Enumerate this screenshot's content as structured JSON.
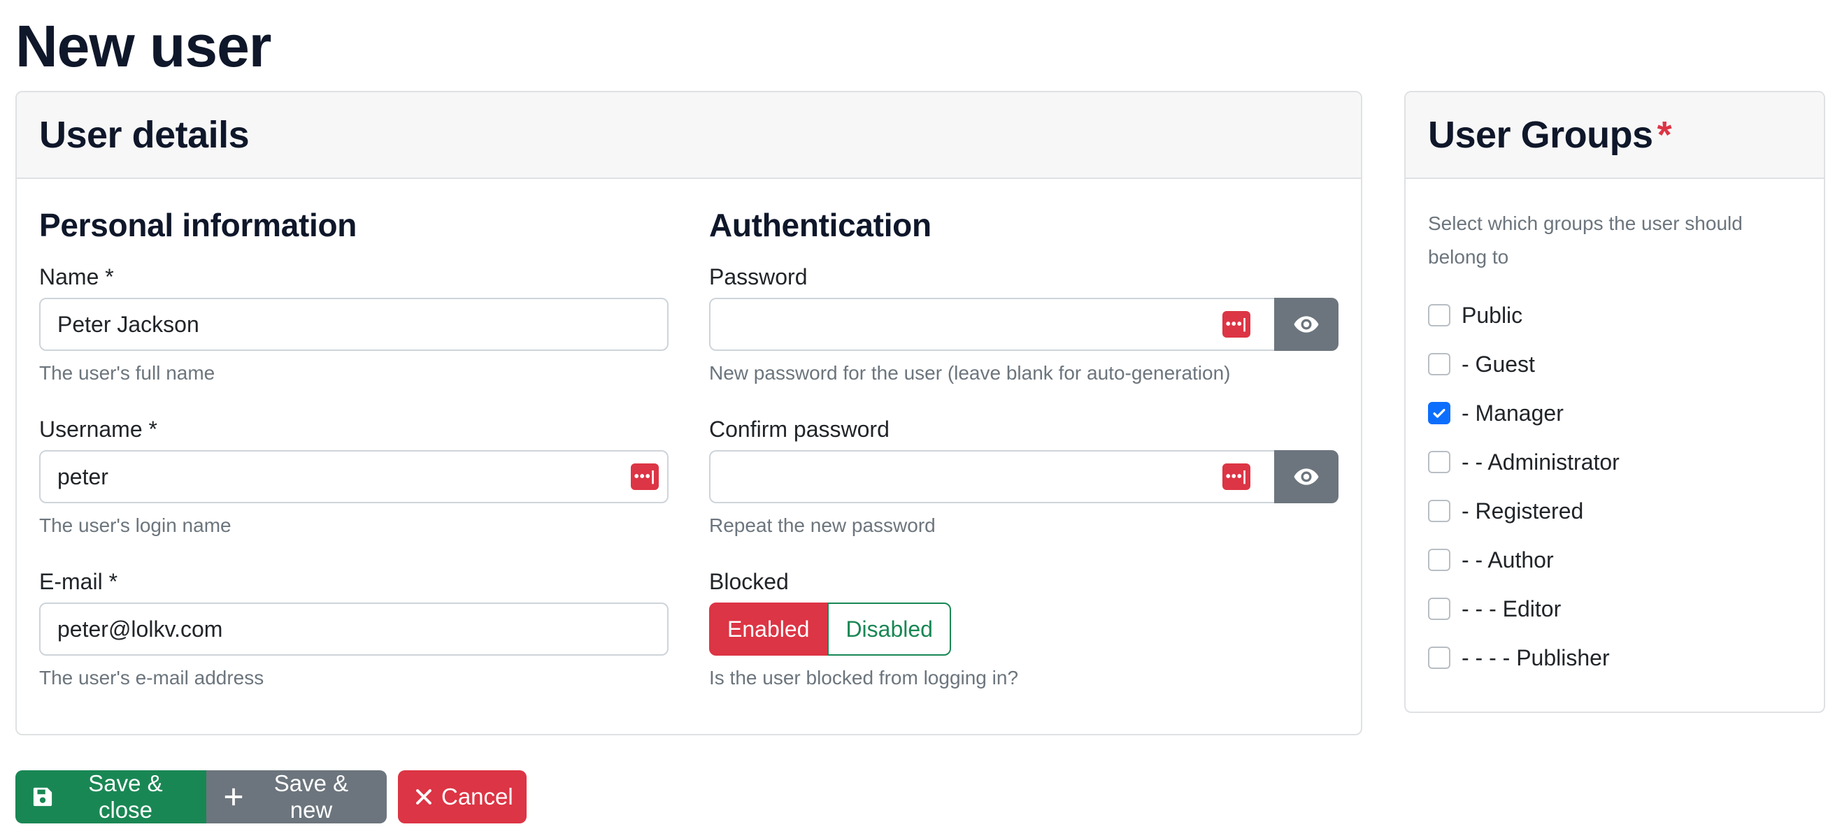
{
  "page": {
    "title": "New user"
  },
  "details": {
    "title": "User details",
    "personal": {
      "title": "Personal information",
      "name": {
        "label": "Name *",
        "value": "Peter Jackson",
        "help": "The user's full name"
      },
      "username": {
        "label": "Username *",
        "value": "peter",
        "help": "The user's login name"
      },
      "email": {
        "label": "E-mail *",
        "value": "peter@lolkv.com",
        "help": "The user's e-mail address"
      }
    },
    "auth": {
      "title": "Authentication",
      "password": {
        "label": "Password",
        "value": "",
        "help": "New password for the user (leave blank for auto-generation)"
      },
      "confirm": {
        "label": "Confirm password",
        "value": "",
        "help": "Repeat the new password"
      },
      "blocked": {
        "label": "Blocked",
        "enabled": "Enabled",
        "disabled": "Disabled",
        "selected": "Enabled",
        "help": "Is the user blocked from logging in?"
      }
    },
    "password_manager_badge": "•••|"
  },
  "groups": {
    "title": "User Groups",
    "required_marker": "*",
    "description": "Select which groups the user should belong to",
    "items": [
      {
        "label": "Public",
        "checked": false
      },
      {
        "label": "- Guest",
        "checked": false
      },
      {
        "label": "- Manager",
        "checked": true
      },
      {
        "label": "- - Administrator",
        "checked": false
      },
      {
        "label": "- Registered",
        "checked": false
      },
      {
        "label": "- - Author",
        "checked": false
      },
      {
        "label": "- - - Editor",
        "checked": false
      },
      {
        "label": "- - - - Publisher",
        "checked": false
      }
    ]
  },
  "actions": {
    "save_close": {
      "label": "Save & close",
      "icon": "floppy-disk-icon"
    },
    "save_new": {
      "label": "Save & new",
      "icon": "plus-icon"
    },
    "cancel": {
      "label": "Cancel",
      "icon": "close-icon"
    }
  },
  "colors": {
    "primary": "#0d6efd",
    "success": "#198754",
    "danger": "#dc3545",
    "secondary": "#6c757d"
  }
}
